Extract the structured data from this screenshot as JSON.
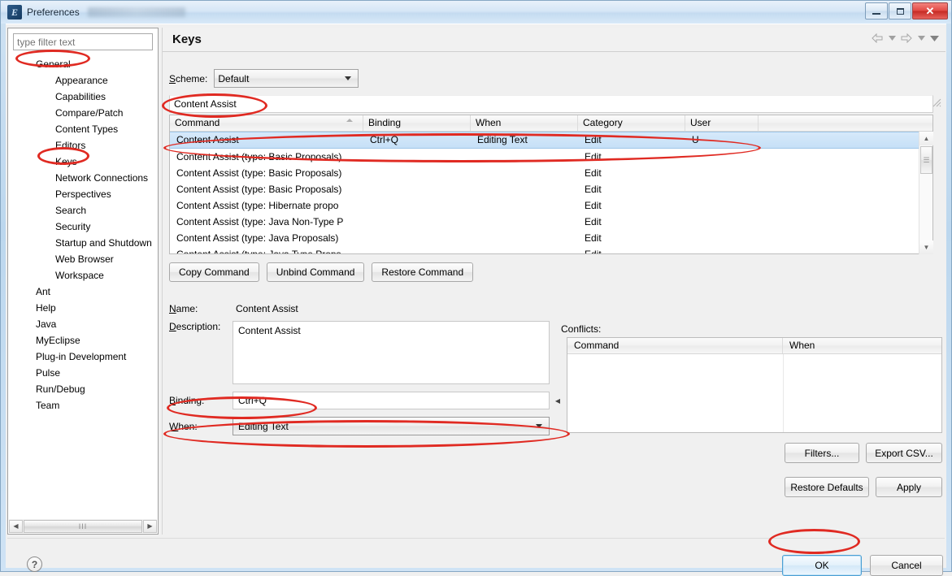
{
  "window": {
    "title": "Preferences",
    "app_icon": "eclipse-icon",
    "controls": {
      "minimize": "minimize-icon",
      "maximize": "maximize-icon",
      "close": "✕"
    }
  },
  "sidebar": {
    "filter_placeholder": "type filter text",
    "filter_value": "",
    "items": [
      {
        "label": "General",
        "level": 0
      },
      {
        "label": "Appearance",
        "level": 1
      },
      {
        "label": "Capabilities",
        "level": 1
      },
      {
        "label": "Compare/Patch",
        "level": 1
      },
      {
        "label": "Content Types",
        "level": 1
      },
      {
        "label": "Editors",
        "level": 1
      },
      {
        "label": "Keys",
        "level": 1
      },
      {
        "label": "Network Connections",
        "level": 1
      },
      {
        "label": "Perspectives",
        "level": 1
      },
      {
        "label": "Search",
        "level": 1
      },
      {
        "label": "Security",
        "level": 1
      },
      {
        "label": "Startup and Shutdown",
        "level": 1
      },
      {
        "label": "Web Browser",
        "level": 1
      },
      {
        "label": "Workspace",
        "level": 1
      },
      {
        "label": "Ant",
        "level": 0
      },
      {
        "label": "Help",
        "level": 0
      },
      {
        "label": "Java",
        "level": 0
      },
      {
        "label": "MyEclipse",
        "level": 0
      },
      {
        "label": "Plug-in Development",
        "level": 0
      },
      {
        "label": "Pulse",
        "level": 0
      },
      {
        "label": "Run/Debug",
        "level": 0
      },
      {
        "label": "Team",
        "level": 0
      }
    ],
    "hscroll_grip": "III"
  },
  "page": {
    "title": "Keys",
    "nav": {
      "back": "back-arrow-icon",
      "back_menu": "chevron-down-icon",
      "forward": "forward-arrow-icon",
      "forward_menu": "chevron-down-icon",
      "view_menu": "chevron-down-icon"
    },
    "scheme": {
      "label": "Scheme:",
      "value": "Default"
    },
    "search": {
      "value": "Content Assist",
      "placeholder": "type filter text"
    },
    "table": {
      "columns": [
        "Command",
        "Binding",
        "When",
        "Category",
        "User"
      ],
      "sorted_column": "Command",
      "rows": [
        {
          "command": "Content Assist",
          "binding": "Ctrl+Q",
          "when": "Editing Text",
          "category": "Edit",
          "user": "U",
          "selected": true
        },
        {
          "command": "Content Assist (type: Basic Proposals)",
          "binding": "",
          "when": "",
          "category": "Edit",
          "user": "",
          "selected": false
        },
        {
          "command": "Content Assist (type: Basic Proposals)",
          "binding": "",
          "when": "",
          "category": "Edit",
          "user": "",
          "selected": false
        },
        {
          "command": "Content Assist (type: Basic Proposals)",
          "binding": "",
          "when": "",
          "category": "Edit",
          "user": "",
          "selected": false
        },
        {
          "command": "Content Assist (type: Hibernate propo",
          "binding": "",
          "when": "",
          "category": "Edit",
          "user": "",
          "selected": false
        },
        {
          "command": "Content Assist (type: Java Non-Type P",
          "binding": "",
          "when": "",
          "category": "Edit",
          "user": "",
          "selected": false
        },
        {
          "command": "Content Assist (type: Java Proposals)",
          "binding": "",
          "when": "",
          "category": "Edit",
          "user": "",
          "selected": false
        },
        {
          "command": "Content Assist (type: Java Type Props",
          "binding": "",
          "when": "",
          "category": "Edit",
          "user": "",
          "selected": false
        }
      ]
    },
    "command_buttons": [
      {
        "label": "Copy Command",
        "mnemonic": "C"
      },
      {
        "label": "Unbind Command",
        "mnemonic": "U"
      },
      {
        "label": "Restore Command",
        "mnemonic": "t"
      }
    ],
    "details": {
      "name_label": "Name:",
      "name_value": "Content Assist",
      "description_label": "Description:",
      "description_value": "Content Assist",
      "binding_label": "Binding:",
      "binding_value": "Ctrl+Q",
      "when_label": "When:",
      "when_value": "Editing Text"
    },
    "conflicts": {
      "label": "Conflicts:",
      "columns": [
        "Command",
        "When"
      ],
      "rows": []
    },
    "action_buttons": [
      {
        "label": "Filters..."
      },
      {
        "label": "Export CSV..."
      },
      {
        "label": "Restore Defaults"
      },
      {
        "label": "Apply"
      }
    ]
  },
  "footer": {
    "help": "?",
    "ok": "OK",
    "cancel": "Cancel"
  },
  "annotations": {
    "color": "#e02a22",
    "targets": [
      "General",
      "Keys",
      "Content Assist filter",
      "selected row",
      "Binding",
      "When",
      "OK"
    ]
  }
}
